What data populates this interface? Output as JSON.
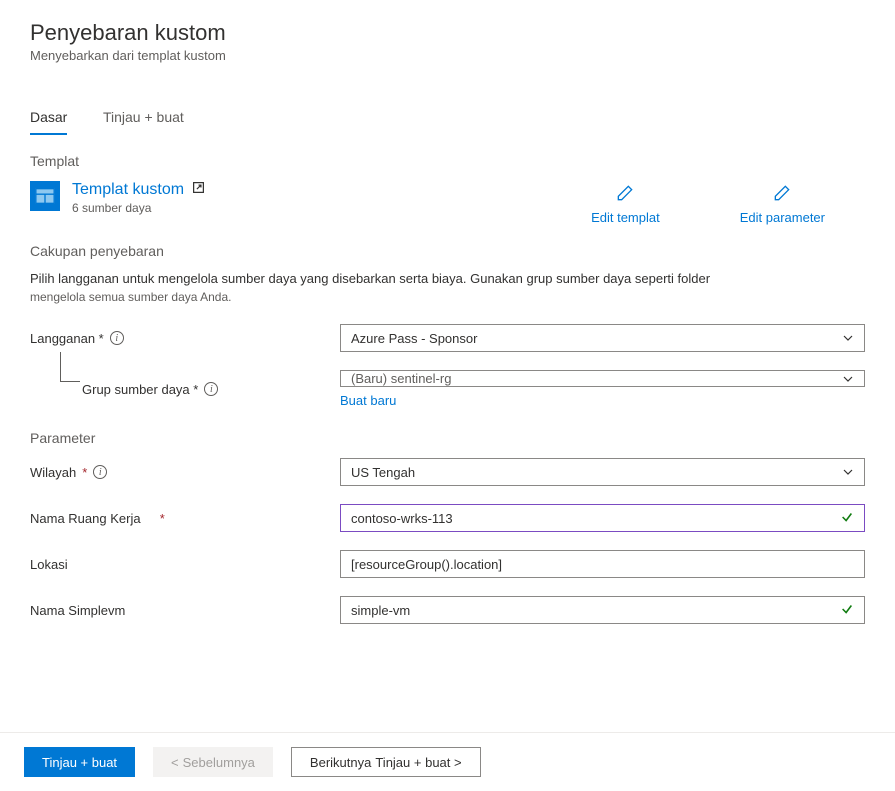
{
  "header": {
    "title": "Penyebaran kustom",
    "subtitle": "Menyebarkan dari templat kustom"
  },
  "tabs": {
    "basic": "Dasar",
    "review": "Tinjau +  buat"
  },
  "template_section": {
    "label": "Templat",
    "title": "Templat kustom",
    "subtitle": "6 sumber daya",
    "edit_template": "Edit templat",
    "edit_parameter": "Edit parameter"
  },
  "scope_section": {
    "label": "Cakupan penyebaran",
    "desc1": "Pilih langganan untuk mengelola sumber daya yang disebarkan serta biaya. Gunakan grup sumber daya seperti folder",
    "desc2": "mengelola semua sumber daya Anda.",
    "subscription_label": "Langganan *",
    "subscription_value": "Azure Pass -  Sponsor",
    "resource_group_label": "Grup sumber daya *",
    "resource_group_value": "(Baru) sentinel-rg",
    "create_new": "Buat baru"
  },
  "param_section": {
    "label": "Parameter",
    "region_label": "Wilayah",
    "region_value": "US Tengah",
    "workspace_label": "Nama Ruang Kerja",
    "workspace_value": "contoso-wrks-113",
    "location_label": "Lokasi",
    "location_value": "[resourceGroup().location]",
    "simplevm_label": "Nama Simplevm",
    "simplevm_value": "simple-vm"
  },
  "footer": {
    "review": "Tinjau +  buat",
    "prev": "Sebelumnya",
    "next_a": "Berikutnya",
    "next_b": "Tinjau +  buat  >"
  }
}
